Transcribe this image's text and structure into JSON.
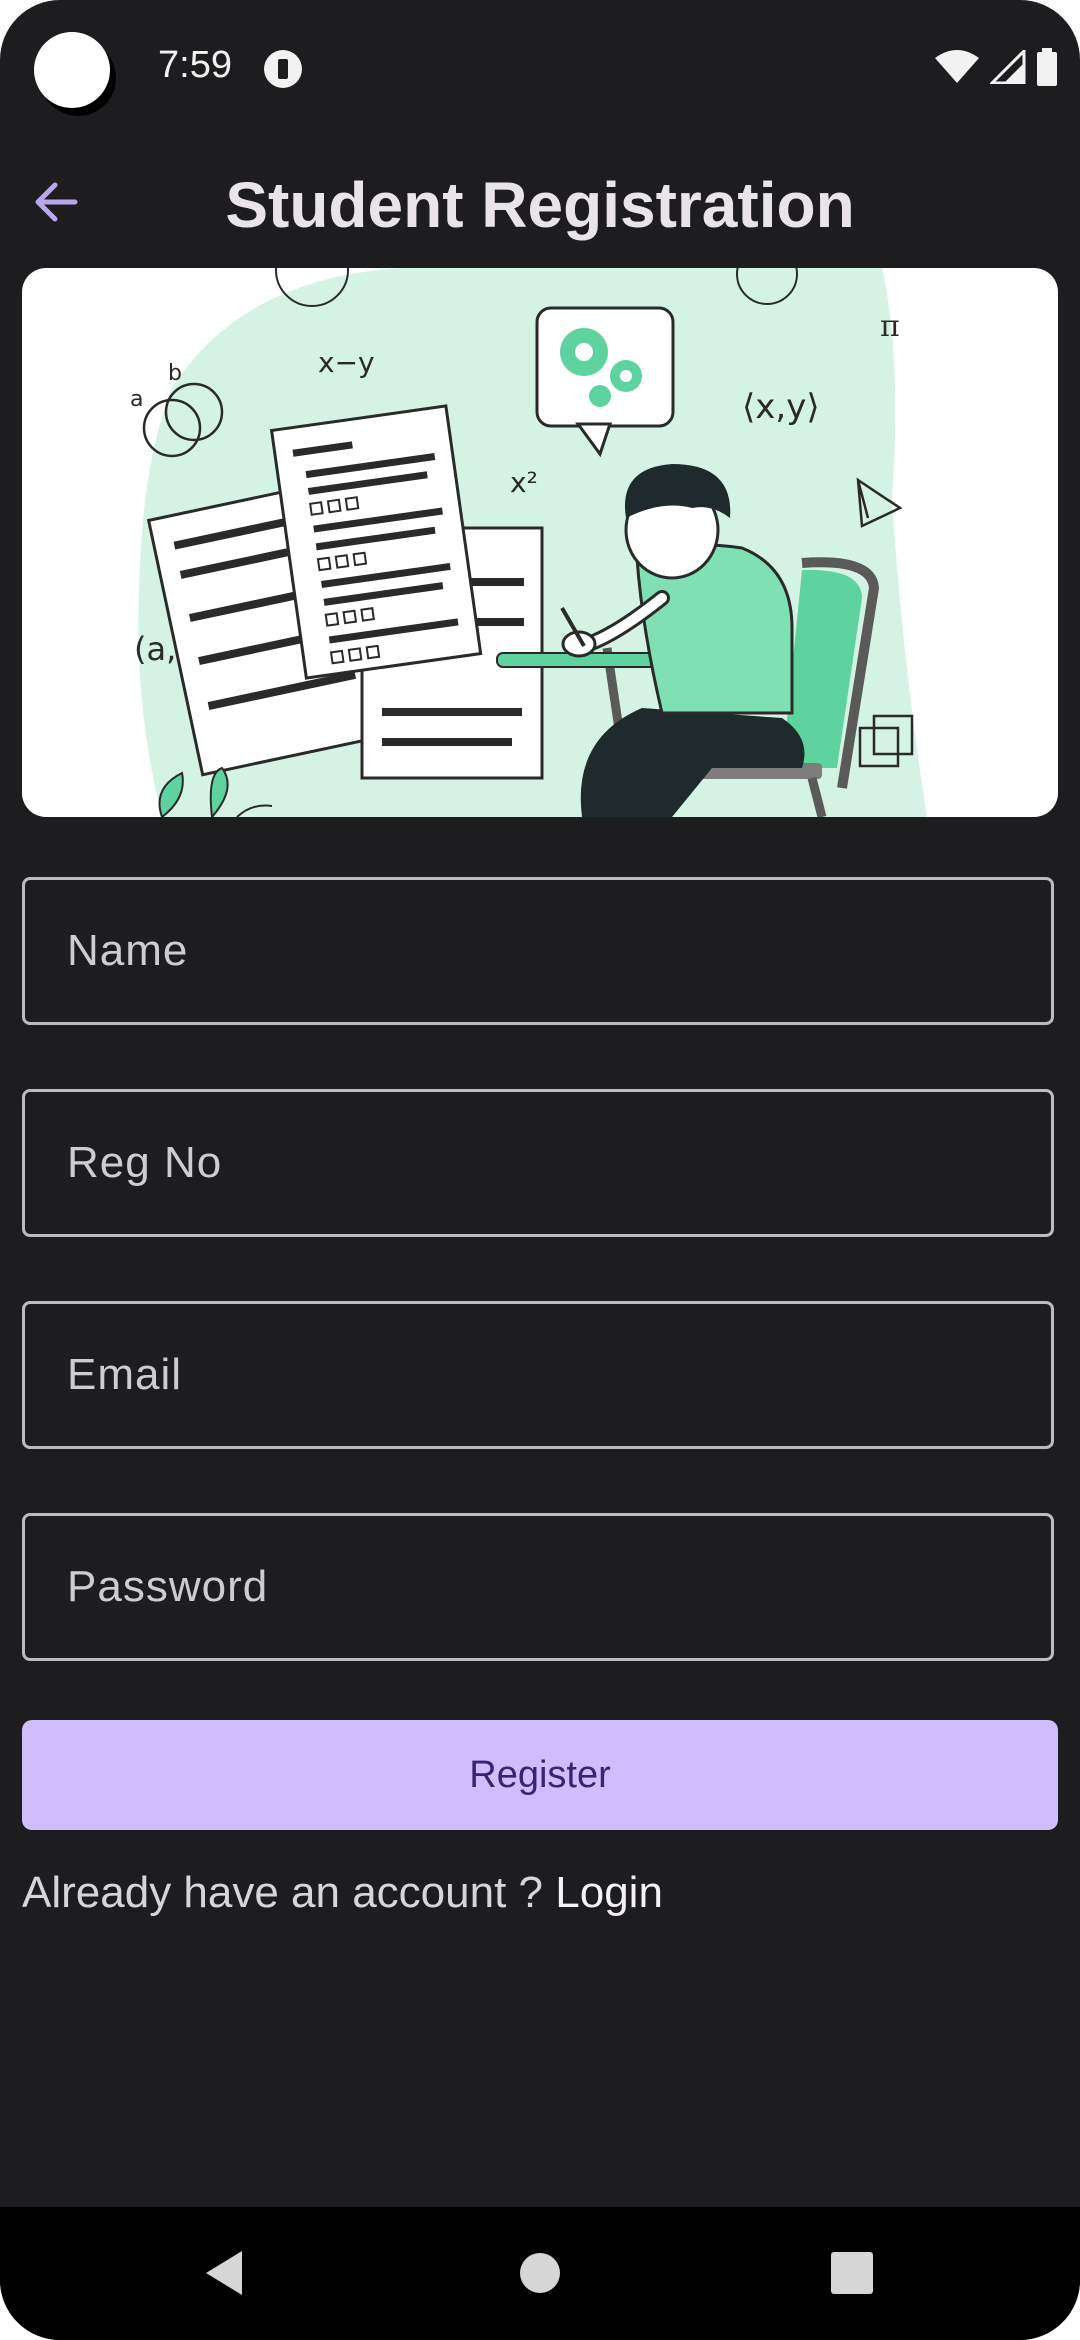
{
  "status_bar": {
    "time": "7:59"
  },
  "header": {
    "title": "Student Registration",
    "back_icon": "arrow-back-icon"
  },
  "form": {
    "name_placeholder": "Name",
    "reg_no_placeholder": "Reg No",
    "email_placeholder": "Email",
    "password_placeholder": "Password",
    "register_label": "Register"
  },
  "footer": {
    "prompt": "Already have an account ?",
    "login_label": "Login"
  },
  "colors": {
    "background": "#1d1d20",
    "accent": "#cfbdfe",
    "accent_text": "#3a2372",
    "back_arrow": "#b9a6ef",
    "illustration_green": "#5fd39f"
  },
  "navigation": {
    "back": "nav-back-icon",
    "home": "nav-home-icon",
    "recents": "nav-recents-icon"
  }
}
